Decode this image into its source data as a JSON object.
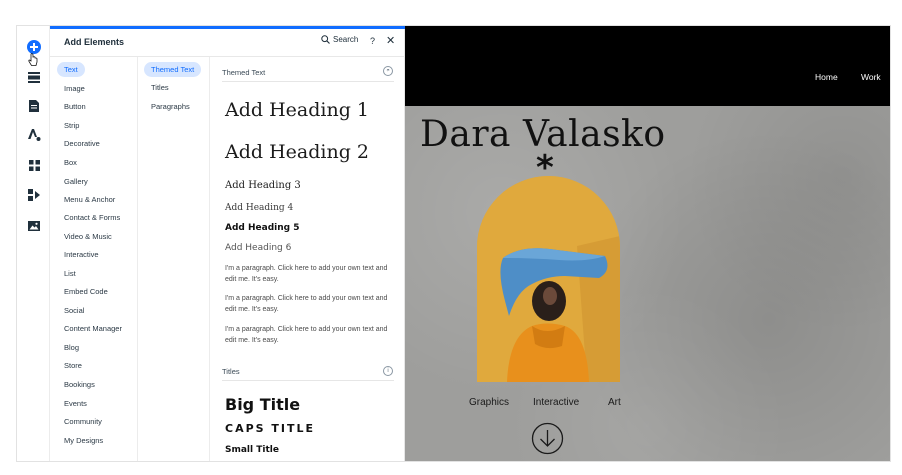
{
  "panel": {
    "title": "Add Elements",
    "search_label": "Search",
    "help_label": "?",
    "close_label": "✕"
  },
  "categories": [
    {
      "label": "Text",
      "active": true
    },
    {
      "label": "Image"
    },
    {
      "label": "Button"
    },
    {
      "label": "Strip"
    },
    {
      "label": "Decorative"
    },
    {
      "label": "Box"
    },
    {
      "label": "Gallery"
    },
    {
      "label": "Menu & Anchor"
    },
    {
      "label": "Contact & Forms"
    },
    {
      "label": "Video & Music"
    },
    {
      "label": "Interactive"
    },
    {
      "label": "List"
    },
    {
      "label": "Embed Code"
    },
    {
      "label": "Social"
    },
    {
      "label": "Content Manager"
    },
    {
      "label": "Blog"
    },
    {
      "label": "Store"
    },
    {
      "label": "Bookings"
    },
    {
      "label": "Events"
    },
    {
      "label": "Community"
    },
    {
      "label": "My Designs"
    }
  ],
  "subcategories": [
    {
      "label": "Themed Text",
      "active": true
    },
    {
      "label": "Titles"
    },
    {
      "label": "Paragraphs"
    }
  ],
  "themed_text": {
    "section_label": "Themed Text",
    "headings": [
      "Add Heading 1",
      "Add Heading 2",
      "Add Heading 3",
      "Add Heading 4",
      "Add Heading 5",
      "Add Heading 6"
    ],
    "paragraphs": [
      "I'm a paragraph. Click here to add your own text and edit me. It's easy.",
      "I'm a paragraph. Click here to add your own text and edit me. It's easy.",
      "I'm a paragraph. Click here to add your own text and edit me. It's easy."
    ]
  },
  "titles": {
    "section_label": "Titles",
    "items": [
      "Big Title",
      "CAPS TITLE",
      "Small Title"
    ]
  },
  "site": {
    "nav": [
      "Home",
      "Work"
    ],
    "title": "Dara Valasko",
    "asterisk": "*",
    "links": [
      "Graphics",
      "Interactive",
      "Art"
    ]
  },
  "colors": {
    "accent": "#116dff",
    "active_bg": "#d7e6ff",
    "arch": "#e0a93d",
    "header": "#000000"
  },
  "icons": {
    "rail": [
      "add-icon",
      "sections-icon",
      "pages-icon",
      "design-icon",
      "apps-icon",
      "business-icon",
      "media-icon"
    ]
  }
}
